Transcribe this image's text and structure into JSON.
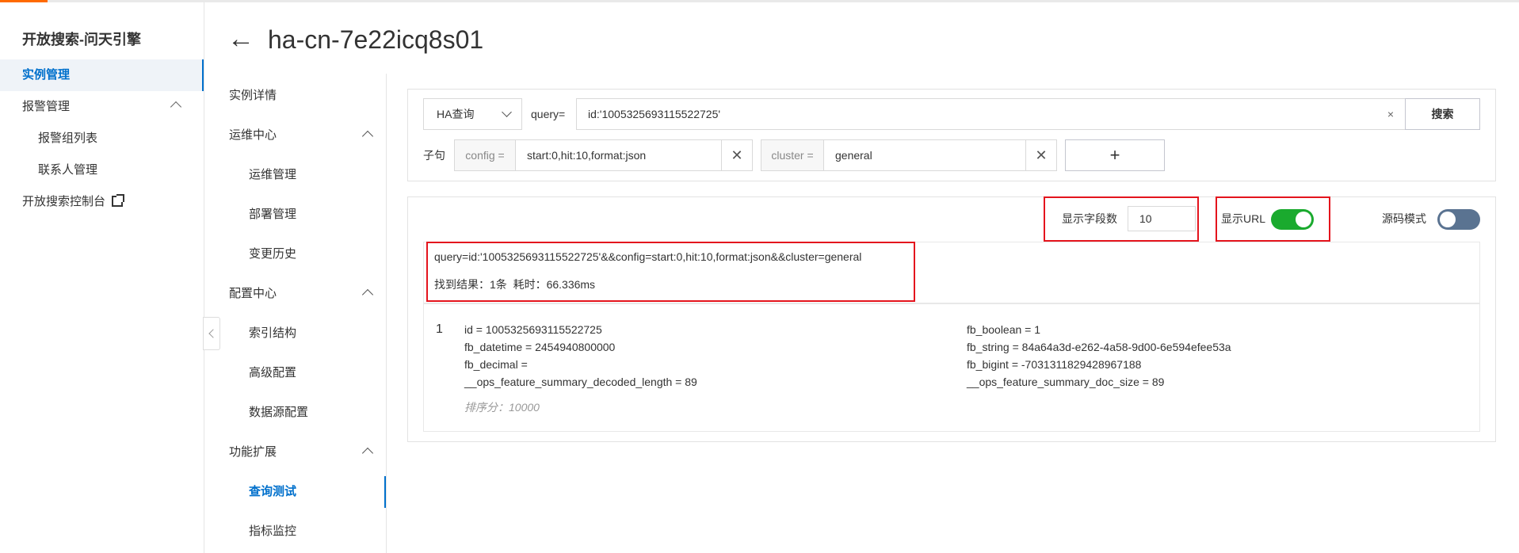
{
  "sidebar": {
    "title": "开放搜索-问天引擎",
    "items": [
      {
        "label": "实例管理"
      },
      {
        "label": "报警管理"
      },
      {
        "label": "报警组列表"
      },
      {
        "label": "联系人管理"
      },
      {
        "label": "开放搜索控制台"
      }
    ]
  },
  "header": {
    "back_icon": "arrow-left-icon",
    "title": "ha-cn-7e22icq8s01"
  },
  "subnav": {
    "items": [
      {
        "label": "实例详情"
      },
      {
        "label": "运维中心"
      },
      {
        "label": "运维管理"
      },
      {
        "label": "部署管理"
      },
      {
        "label": "变更历史"
      },
      {
        "label": "配置中心"
      },
      {
        "label": "索引结构"
      },
      {
        "label": "高级配置"
      },
      {
        "label": "数据源配置"
      },
      {
        "label": "功能扩展"
      },
      {
        "label": "查询测试"
      },
      {
        "label": "指标监控"
      }
    ]
  },
  "query": {
    "type_select": "HA查询",
    "query_label": "query=",
    "query_value": "id:'1005325693115522725'",
    "clear": "×",
    "search_button": "搜索",
    "clause_label": "子句",
    "config_prefix": "config =",
    "config_value": "start:0,hit:10,format:json",
    "cluster_prefix": "cluster =",
    "cluster_value": "general",
    "remove": "✕",
    "add": "+"
  },
  "options": {
    "field_count_label": "显示字段数",
    "field_count_value": "10",
    "show_url_label": "显示URL",
    "show_url": true,
    "source_mode_label": "源码模式",
    "source_mode": false
  },
  "result": {
    "url": "query=id:'1005325693115522725'&&config=start:0,hit:10,format:json&&cluster=general",
    "summary": "找到结果：1条  耗时：66.336ms",
    "index": "1",
    "left_fields": [
      "id = 1005325693115522725",
      "fb_datetime = 2454940800000",
      "fb_decimal =",
      "__ops_feature_summary_decoded_length = 89"
    ],
    "right_fields": [
      "fb_boolean = 1",
      "fb_string = 84a64a3d-e262-4a58-9d00-6e594efee53a",
      "fb_bigint = -7031311829428967188",
      "__ops_feature_summary_doc_size = 89"
    ],
    "score": "排序分：10000"
  },
  "colors": {
    "accent": "#0070cc",
    "highlight": "#e4141d",
    "toggle_on": "#1aaa2e"
  }
}
